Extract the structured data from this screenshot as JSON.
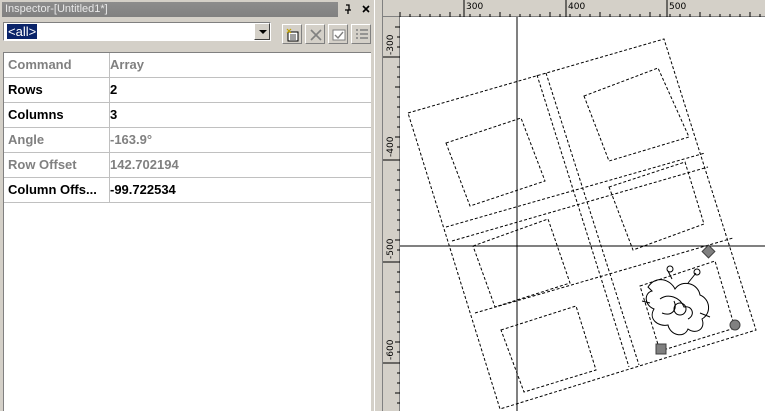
{
  "inspector": {
    "title": "Inspector-[Untitled1*]",
    "pin_glyph": "ᵖ",
    "close_glyph": "×",
    "selection": "<all>"
  },
  "toolbar": {
    "icons": [
      "new-icon",
      "delete-icon",
      "check-icon",
      "list-icon"
    ]
  },
  "properties": [
    {
      "key": "Command",
      "value": "Array",
      "dim": true
    },
    {
      "key": "Rows",
      "value": "2",
      "dim": false
    },
    {
      "key": "Columns",
      "value": "3",
      "dim": false
    },
    {
      "key": "Angle",
      "value": "-163.9°",
      "dim": true
    },
    {
      "key": "Row Offset",
      "value": "142.702194",
      "dim": true
    },
    {
      "key": "Column Offs...",
      "value": "-99.722534",
      "dim": false
    }
  ],
  "ruler": {
    "top": [
      "300",
      "400",
      "500"
    ],
    "left": [
      "-300",
      "-400",
      "-500",
      "-600"
    ]
  },
  "colors": {
    "selection_bg": "#0a246a",
    "handle_fill": "#808080"
  }
}
